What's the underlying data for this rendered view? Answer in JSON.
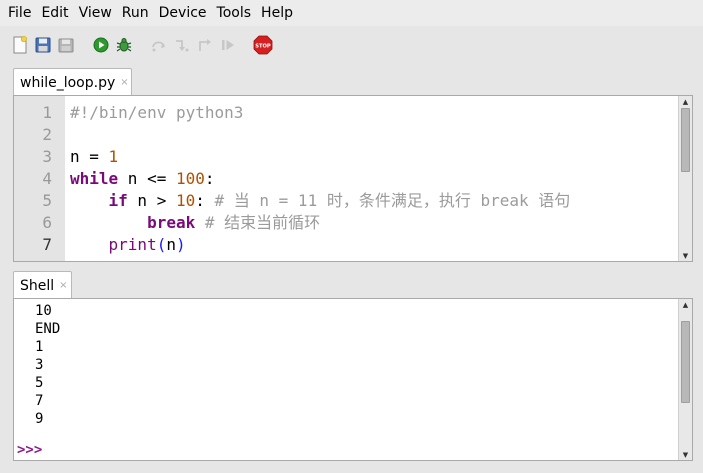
{
  "menu": [
    "File",
    "Edit",
    "View",
    "Run",
    "Device",
    "Tools",
    "Help"
  ],
  "toolbar": {
    "icons": [
      "new-file-icon",
      "save-icon",
      "save-all-icon",
      "run-icon",
      "debug-icon",
      "step-over-icon",
      "step-into-icon",
      "step-out-icon",
      "resume-icon",
      "stop-icon"
    ],
    "stop_label": "STOP",
    "colors": {
      "run": "#2e9a2e",
      "stop": "#d42020"
    }
  },
  "editor": {
    "tab_title": "while_loop.py",
    "tab_close": "×",
    "line_numbers": [
      "1",
      "2",
      "3",
      "4",
      "5",
      "6",
      "7"
    ],
    "current_line": "7",
    "lines": [
      [
        {
          "t": "#!/bin/env python3",
          "c": "c-comment"
        }
      ],
      [],
      [
        {
          "t": "n = ",
          "c": "c-plain"
        },
        {
          "t": "1",
          "c": "c-num"
        }
      ],
      [
        {
          "t": "while",
          "c": "c-kw"
        },
        {
          "t": " n <= ",
          "c": "c-plain"
        },
        {
          "t": "100",
          "c": "c-num"
        },
        {
          "t": ":",
          "c": "c-plain"
        }
      ],
      [
        {
          "t": "    ",
          "c": "c-plain"
        },
        {
          "t": "if",
          "c": "c-kw"
        },
        {
          "t": " n > ",
          "c": "c-plain"
        },
        {
          "t": "10",
          "c": "c-num"
        },
        {
          "t": ": ",
          "c": "c-plain"
        },
        {
          "t": "# 当 n = 11 时，条件满足，执行 break 语句",
          "c": "c-comment"
        }
      ],
      [
        {
          "t": "        ",
          "c": "c-plain"
        },
        {
          "t": "break",
          "c": "c-kw"
        },
        {
          "t": " ",
          "c": "c-plain"
        },
        {
          "t": "# 结束当前循环",
          "c": "c-comment"
        }
      ],
      [
        {
          "t": "    ",
          "c": "c-plain"
        },
        {
          "t": "print",
          "c": "c-builtin"
        },
        {
          "t": "(",
          "c": "c-paren"
        },
        {
          "t": "n",
          "c": "c-plain"
        },
        {
          "t": ")",
          "c": "c-paren"
        }
      ]
    ]
  },
  "shell": {
    "tab_title": "Shell",
    "tab_close": "×",
    "output": [
      "10",
      "END",
      "1",
      "3",
      "5",
      "7",
      "9"
    ],
    "prompt": ">>>"
  }
}
